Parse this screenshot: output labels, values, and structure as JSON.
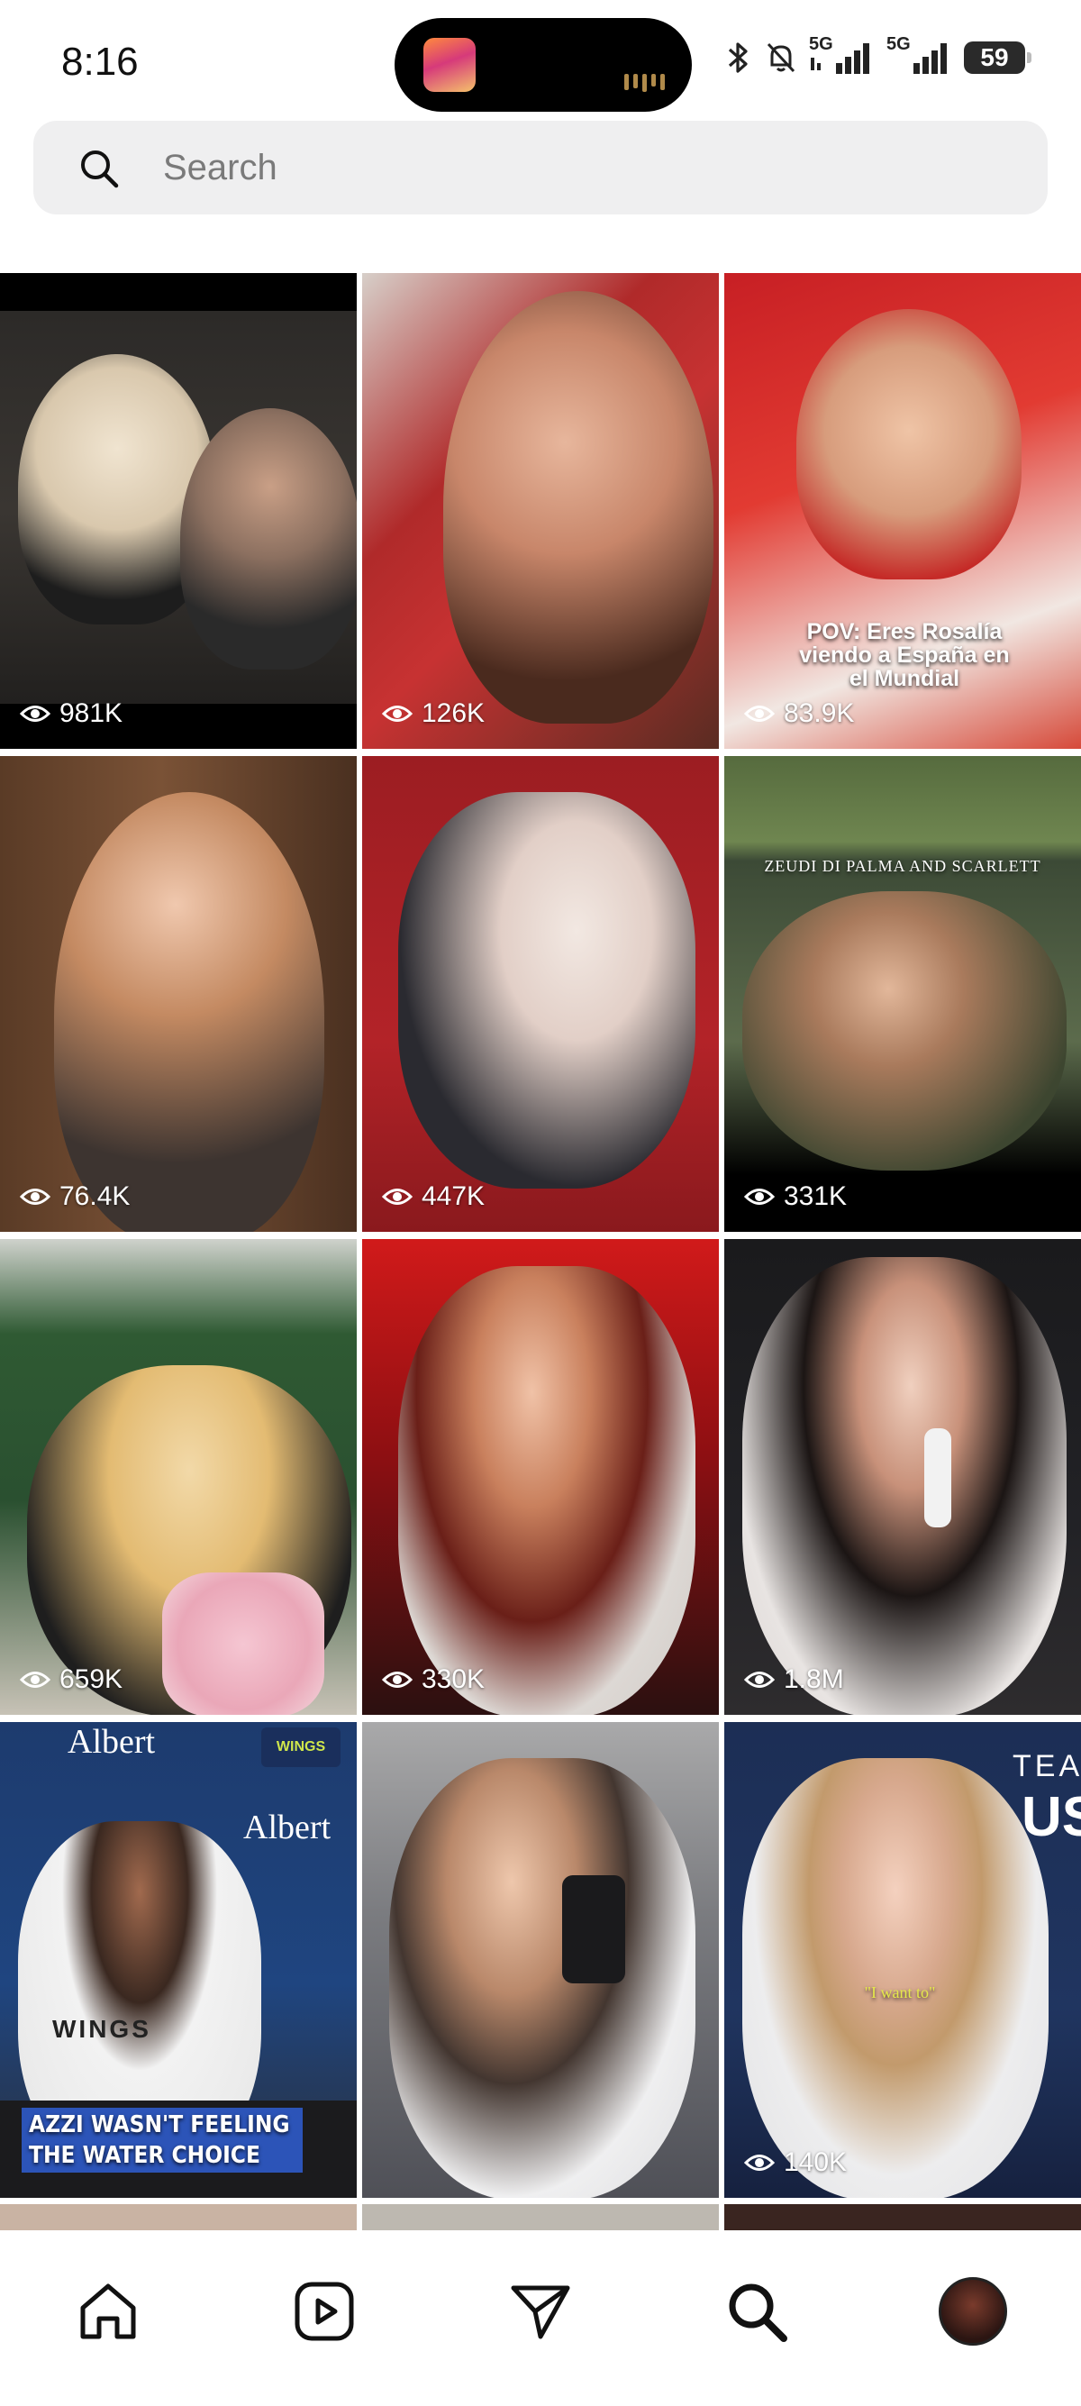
{
  "status_bar": {
    "time": "8:16",
    "network_1": "5G",
    "network_2": "5G",
    "battery": "59"
  },
  "search": {
    "placeholder": "Search"
  },
  "grid": {
    "tiles": [
      {
        "views": "981K",
        "caption": ""
      },
      {
        "views": "126K",
        "caption": ""
      },
      {
        "views": "83.9K",
        "caption": "POV: Eres Rosalía viendo a España en el Mundial"
      },
      {
        "views": "76.4K",
        "caption": ""
      },
      {
        "views": "447K",
        "caption": ""
      },
      {
        "views": "331K",
        "caption": "ZEUDI DI PALMA AND SCARLETT"
      },
      {
        "views": "659K",
        "caption": ""
      },
      {
        "views": "330K",
        "caption": ""
      },
      {
        "views": "1.8M",
        "caption": ""
      },
      {
        "views": "",
        "caption": "AZZI WASN'T FEELING THE WATER CHOICE",
        "sign_top": "Albert",
        "sign_mid": "Albert",
        "badge": "WINGS",
        "jersey": "WINGS"
      },
      {
        "views": "",
        "caption": ""
      },
      {
        "views": "140K",
        "caption": "\"I want to\"",
        "sign_top": "TEA",
        "sign_mid": "US"
      }
    ]
  },
  "bottom_nav": {
    "items": [
      "home-icon",
      "reels-icon",
      "send-icon",
      "search-icon",
      "profile-avatar"
    ],
    "active": "search-icon"
  }
}
